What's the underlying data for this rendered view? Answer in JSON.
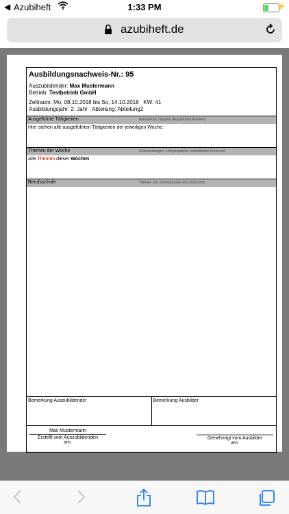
{
  "status": {
    "app": "Azubiheft",
    "time": "1:33 PM"
  },
  "browser": {
    "host": "azubiheft.de"
  },
  "report": {
    "title": "Ausbildungsnachweis-Nr.: 95",
    "trainee_label": "Auszubildender:",
    "trainee_name": "Max Mustermann",
    "company_label": "Betrieb:",
    "company_name": "Testbetrieb GmbH",
    "period_label": "Zeitraum:",
    "period_value": "Mo, 08.10.2018 bis So, 14.10.2018",
    "week_label": "KW:",
    "week_value": "41",
    "year_label": "Ausbildungsjahr:",
    "year_value": "2. Jahr",
    "department_label": "Abteilung:",
    "department_value": "Abteilung2"
  },
  "sections": {
    "activities": {
      "heading": "Ausgeführte Tätigkeiten",
      "sub": "Betriebliche Tätigkeit (Ausgeführte Arbeiten)",
      "text": "Hier stehen alle ausgeführten Tätigkeiten der jeweiligen Woche."
    },
    "topics": {
      "heading": "Themen der Woche",
      "sub": "Unterweisungen, Lehrgespräche, betrieblicher Unterricht",
      "text_prefix": "Alle",
      "text_highlight": "Themen",
      "text_middle": "dieser",
      "text_bold": "Wochen"
    },
    "school": {
      "heading": "Berufsschule",
      "sub": "Themen und Schwerpunkte des Unterrichts"
    }
  },
  "remarks": {
    "trainee": "Bemerkung Auszubildender",
    "trainer": "Bemerkung Ausbilder"
  },
  "signatures": {
    "trainee_name": "Max Mustermann",
    "created_label": "Erstellt vom Auszubildenden",
    "created_on": "am:",
    "approved_label": "Genehmigt vom Ausbilder",
    "approved_on": "am:"
  },
  "colors": {
    "highlight": "#c00000",
    "section_bar": "#b3b3b3",
    "toolbar_icon": "#1f7cf5"
  },
  "icons": [
    "back-arrow-icon",
    "wifi-icon",
    "battery-icon",
    "lock-icon",
    "reload-icon",
    "chevron-left-icon",
    "chevron-right-icon",
    "share-icon",
    "bookmarks-icon",
    "tabs-icon"
  ]
}
